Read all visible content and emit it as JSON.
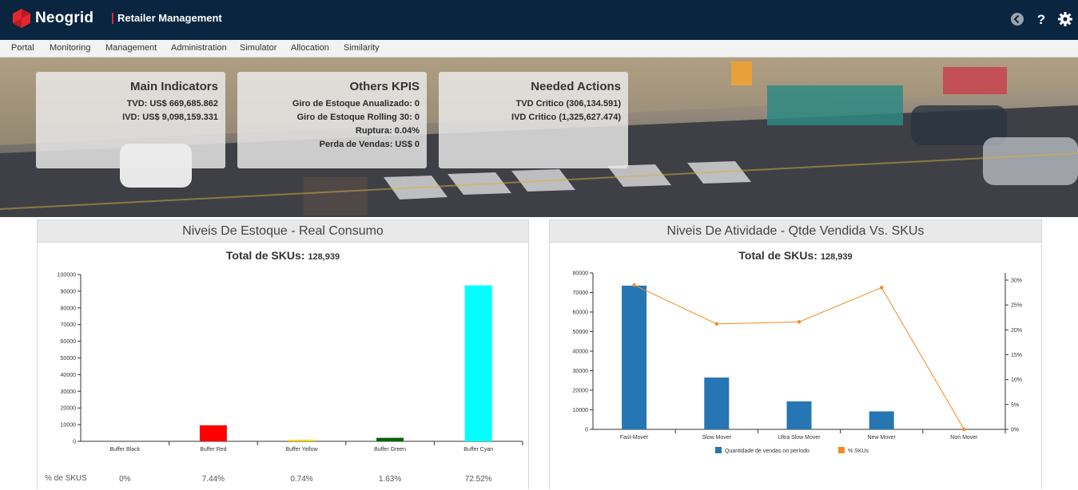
{
  "header": {
    "brand": "Neogrid",
    "module": "Retailer Management",
    "icons": [
      "back-icon",
      "help-icon",
      "gear-icon"
    ],
    "colors": {
      "topbar": "#0a2540",
      "accent": "#e3262d"
    }
  },
  "menu": [
    "Portal",
    "Monitoring",
    "Management",
    "Administration",
    "Simulator",
    "Allocation",
    "Similarity"
  ],
  "cards": [
    {
      "title": "Main Indicators",
      "lines": [
        "TVD: US$ 669,685.862",
        "IVD: US$ 9,098,159.331"
      ]
    },
    {
      "title": "Others KPIS",
      "lines": [
        "Giro de Estoque Anualizado: 0",
        "Giro de Estoque Rolling 30: 0",
        "Ruptura: 0.04%",
        "Perda de Vendas: US$ 0"
      ]
    },
    {
      "title": "Needed Actions",
      "lines": [
        "TVD Critico (306,134.591)",
        "IVD Critico (1,325,627.474)"
      ]
    }
  ],
  "panels": {
    "left": {
      "title": "Niveis De Estoque - Real Consumo",
      "total_label": "Total de SKUs:",
      "total_value": "128,939",
      "pct_label": "% de SKUS"
    },
    "right": {
      "title": "Niveis De Atividade - Qtde Vendida Vs. SKUs",
      "total_label": "Total de SKUs:",
      "total_value": "128,939"
    }
  },
  "chart_data": [
    {
      "type": "bar",
      "categories": [
        "Buffer Black",
        "Buffer Red",
        "Buffer Yellow",
        "Buffer Green",
        "Buffer Cyan"
      ],
      "values": [
        0,
        9600,
        950,
        2100,
        93500
      ],
      "colors": [
        "#000000",
        "#ff0000",
        "#ffd700",
        "#006400",
        "#00ffff"
      ],
      "ylim": [
        0,
        100000
      ],
      "yticks": [
        0,
        10000,
        20000,
        30000,
        40000,
        50000,
        60000,
        70000,
        80000,
        90000,
        100000
      ],
      "percentages": [
        "0%",
        "7.44%",
        "0.74%",
        "1.63%",
        "72.52%"
      ]
    },
    {
      "type": "bar",
      "categories": [
        "Fast-Mover",
        "Slow Mover",
        "Ultra Slow Mover",
        "New Mover",
        "Non Mover"
      ],
      "series": [
        {
          "name": "Quantidade de vendas no período",
          "type": "bar",
          "color": "#2776b4",
          "values": [
            73500,
            26500,
            14300,
            9200,
            0
          ]
        },
        {
          "name": "% SKUs",
          "type": "line",
          "color": "#f58a1f",
          "values": [
            29,
            21.2,
            21.6,
            28.5,
            0
          ]
        }
      ],
      "ylim": [
        0,
        80000
      ],
      "yticks": [
        0,
        10000,
        20000,
        30000,
        40000,
        50000,
        60000,
        70000,
        80000
      ],
      "y2lim": [
        0,
        30
      ],
      "y2ticks": [
        "0%",
        "5%",
        "10%",
        "15%",
        "20%",
        "25%",
        "30%"
      ],
      "legend_placement": "bottom"
    }
  ]
}
